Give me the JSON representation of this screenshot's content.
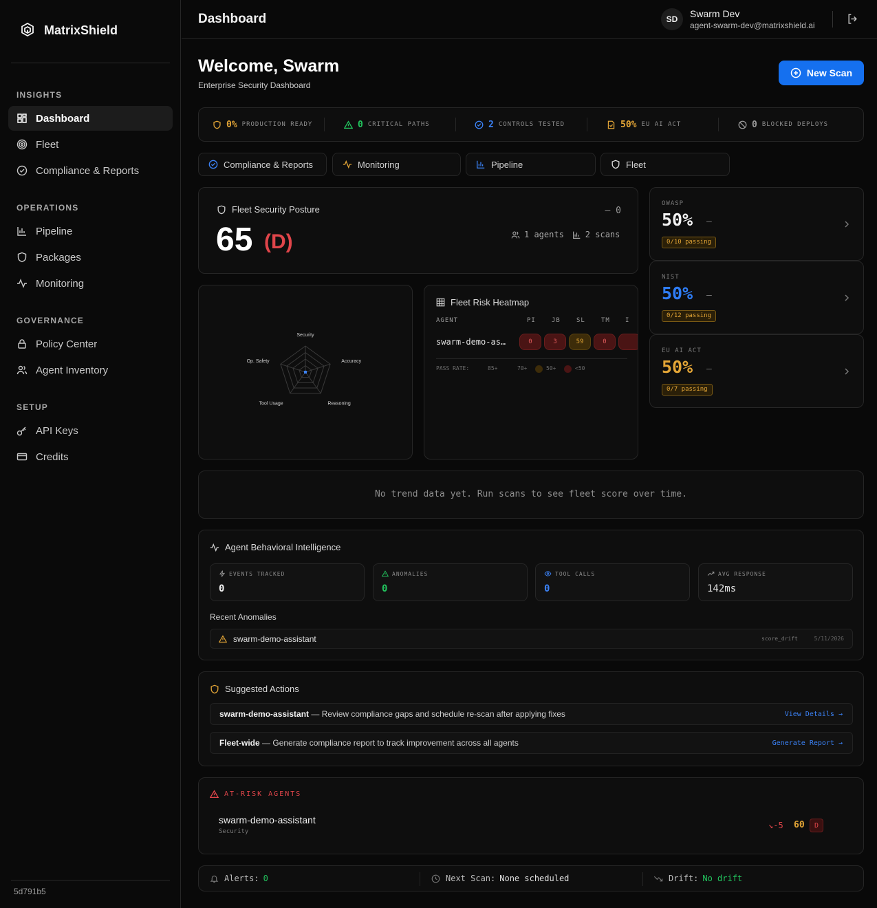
{
  "sidebar": {
    "brand": "MatrixShield",
    "sections": [
      {
        "title": "INSIGHTS",
        "items": [
          {
            "label": "Dashboard",
            "icon": "grid-icon",
            "active": true
          },
          {
            "label": "Fleet",
            "icon": "target-icon"
          },
          {
            "label": "Compliance & Reports",
            "icon": "check-circle-icon"
          }
        ]
      },
      {
        "title": "OPERATIONS",
        "items": [
          {
            "label": "Pipeline",
            "icon": "bar-chart-icon"
          },
          {
            "label": "Packages",
            "icon": "shield-icon"
          },
          {
            "label": "Monitoring",
            "icon": "activity-icon"
          }
        ]
      },
      {
        "title": "GOVERNANCE",
        "items": [
          {
            "label": "Policy Center",
            "icon": "lock-icon"
          },
          {
            "label": "Agent Inventory",
            "icon": "users-icon"
          }
        ]
      },
      {
        "title": "SETUP",
        "items": [
          {
            "label": "API Keys",
            "icon": "key-icon"
          },
          {
            "label": "Credits",
            "icon": "credit-card-icon"
          }
        ]
      }
    ],
    "build": "5d791b5"
  },
  "header": {
    "title": "Dashboard",
    "user": {
      "initials": "SD",
      "name": "Swarm Dev",
      "email": "agent-swarm-dev@matrixshield.ai"
    }
  },
  "welcome": {
    "title": "Welcome, Swarm",
    "subtitle": "Enterprise Security Dashboard",
    "new_scan": "New Scan"
  },
  "stats": [
    {
      "value": "0%",
      "label": "PRODUCTION READY",
      "color": "#e3a536",
      "icon": "shield-icon"
    },
    {
      "value": "0",
      "label": "CRITICAL PATHS",
      "color": "#22c55e",
      "icon": "warning-icon"
    },
    {
      "value": "2",
      "label": "CONTROLS TESTED",
      "color": "#3b82f6",
      "icon": "check-circle-icon"
    },
    {
      "value": "50%",
      "label": "EU AI ACT",
      "color": "#e3a536",
      "icon": "file-check-icon"
    },
    {
      "value": "0",
      "label": "BLOCKED DEPLOYS",
      "color": "#9a9a9a",
      "icon": "ban-icon"
    }
  ],
  "tabs": [
    {
      "label": "Compliance & Reports",
      "icon": "check-circle-icon"
    },
    {
      "label": "Monitoring",
      "icon": "activity-icon"
    },
    {
      "label": "Pipeline",
      "icon": "bar-chart-icon"
    },
    {
      "label": "Fleet",
      "icon": "shield-icon"
    }
  ],
  "posture": {
    "title": "Fleet Security Posture",
    "score": "65",
    "grade": "(D)",
    "delta": "— 0",
    "agents": "1 agents",
    "scans": "2 scans"
  },
  "frameworks": [
    {
      "label": "OWASP",
      "pct": "50%",
      "dash": "–",
      "passing": "0/10 passing",
      "color": "#f2f2f2"
    },
    {
      "label": "NIST",
      "pct": "50%",
      "dash": "–",
      "passing": "0/12 passing",
      "color": "#2f7df6"
    },
    {
      "label": "EU AI ACT",
      "pct": "50%",
      "dash": "–",
      "passing": "0/7 passing",
      "color": "#e3a536"
    }
  ],
  "radar": {
    "axes": [
      "Security",
      "Accuracy",
      "Reasoning",
      "Tool Usage",
      "Op. Safety"
    ],
    "values": [
      0.05,
      0.05,
      0.05,
      0.05,
      0.05
    ]
  },
  "heatmap": {
    "title": "Fleet Risk Heatmap",
    "col_agent": "AGENT",
    "columns": [
      "PI",
      "JB",
      "SL",
      "TM",
      "I"
    ],
    "rows": [
      {
        "agent": "swarm-demo-as…",
        "values": [
          "0",
          "3",
          "59",
          "0",
          ""
        ]
      }
    ],
    "legend": {
      "label": "PASS RATE:",
      "items": [
        "85+",
        "70+",
        "50+",
        "<50"
      ]
    }
  },
  "trend": {
    "empty": "No trend data yet. Run scans to see fleet score over time."
  },
  "behavior": {
    "title": "Agent Behavioral Intelligence",
    "metrics": [
      {
        "label": "EVENTS TRACKED",
        "value": "0",
        "color": "#f2f2f2",
        "icon": "zap-icon"
      },
      {
        "label": "ANOMALIES",
        "value": "0",
        "color": "#22c55e",
        "icon": "warning-icon"
      },
      {
        "label": "TOOL CALLS",
        "value": "0",
        "color": "#3b82f6",
        "icon": "eye-icon"
      },
      {
        "label": "AVG RESPONSE",
        "value": "142ms",
        "color": "#e0e0e0",
        "icon": "trend-up-icon"
      }
    ],
    "recent_title": "Recent Anomalies",
    "anomaly": {
      "agent": "swarm-demo-assistant",
      "type": "score_drift",
      "date": "5/11/2026"
    }
  },
  "suggested": {
    "title": "Suggested Actions",
    "items": [
      {
        "agent": "swarm-demo-assistant",
        "text": " — Review compliance gaps and schedule re-scan after applying fixes",
        "link": "View Details →"
      },
      {
        "agent": "Fleet-wide",
        "text": " — Generate compliance report to track improvement across all agents",
        "link": "Generate Report →"
      }
    ]
  },
  "at_risk": {
    "title": "AT-RISK AGENTS",
    "agent": "swarm-demo-assistant",
    "category": "Security",
    "delta": "↘-5",
    "score": "60",
    "grade": "D"
  },
  "footer": {
    "alerts_label": "Alerts:",
    "alerts_value": "0",
    "next_label": "Next Scan:",
    "next_value": "None scheduled",
    "drift_label": "Drift:",
    "drift_value": "No drift"
  }
}
